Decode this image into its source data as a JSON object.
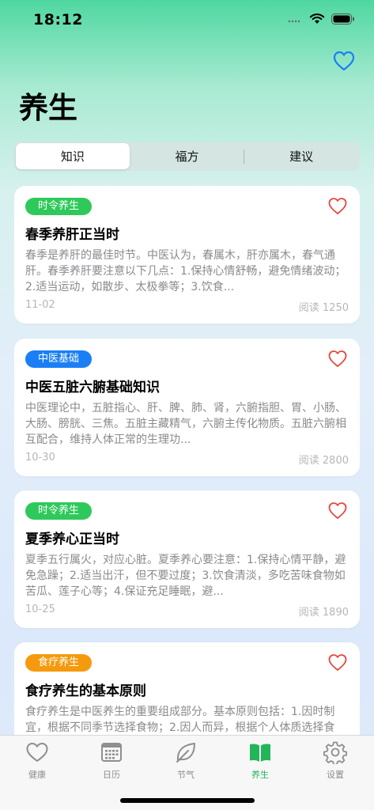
{
  "status_bar": {
    "time": "18:12"
  },
  "header": {
    "title": "养生"
  },
  "segments": [
    {
      "label": "知识",
      "active": true
    },
    {
      "label": "福方",
      "active": false
    },
    {
      "label": "建议",
      "active": false
    }
  ],
  "articles": [
    {
      "tag": "时令养生",
      "tag_color": "#2fc95b",
      "title": "春季养肝正当时",
      "summary": "春季是养肝的最佳时节。中医认为，春属木，肝亦属木，春气通肝。春季养肝要注意以下几点：1.保持心情舒畅，避免情绪波动；2.适当运动，如散步、太极拳等；3.饮食...",
      "date": "11-02",
      "reads": "阅读 1250"
    },
    {
      "tag": "中医基础",
      "tag_color": "#1a7ff5",
      "title": "中医五脏六腑基础知识",
      "summary": "中医理论中，五脏指心、肝、脾、肺、肾，六腑指胆、胃、小肠、大肠、膀胱、三焦。五脏主藏精气，六腑主传化物质。五脏六腑相互配合，维持人体正常的生理功...",
      "date": "10-30",
      "reads": "阅读 2800"
    },
    {
      "tag": "时令养生",
      "tag_color": "#2fc95b",
      "title": "夏季养心正当时",
      "summary": "夏季五行属火，对应心脏。夏季养心要注意：1.保持心情平静，避免急躁；2.适当出汗，但不要过度；3.饮食清淡，多吃苦味食物如苦瓜、莲子心等；4.保证充足睡眠，避...",
      "date": "10-25",
      "reads": "阅读 1890"
    },
    {
      "tag": "食疗养生",
      "tag_color": "#f59a0c",
      "title": "食疗养生的基本原则",
      "summary": "食疗养生是中医养生的重要组成部分。基本原则包括：1.因时制宜，根据不同季节选择食物；2.因人而异，根据个人体质选择食物...",
      "date": "",
      "reads": ""
    }
  ],
  "tabbar": [
    {
      "label": "健康",
      "icon": "heart-icon",
      "active": false
    },
    {
      "label": "日历",
      "icon": "calendar-icon",
      "active": false
    },
    {
      "label": "节气",
      "icon": "leaf-icon",
      "active": false
    },
    {
      "label": "养生",
      "icon": "book-icon",
      "active": true
    },
    {
      "label": "设置",
      "icon": "gear-icon",
      "active": false
    }
  ],
  "colors": {
    "accent_green": "#23b559",
    "accent_blue": "#1a7ff5",
    "heart_red": "#e8453c",
    "tag_green": "#2fc95b",
    "tag_blue": "#1a7ff5",
    "tag_orange": "#f59a0c"
  }
}
